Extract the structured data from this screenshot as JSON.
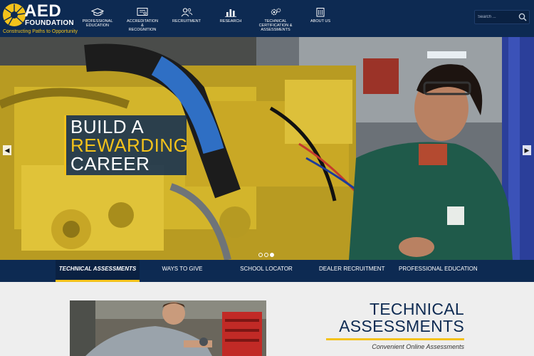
{
  "logo": {
    "name": "AED",
    "subtitle": "FOUNDATION",
    "tagline": "Constructing Paths to Opportunity"
  },
  "nav": {
    "items": [
      {
        "label": "PROFESSIONAL\nEDUCATION",
        "icon": "graduation-cap-icon"
      },
      {
        "label": "ACCREDITATION &\nRECOGNITION",
        "icon": "certificate-icon"
      },
      {
        "label": "RECRUITMENT",
        "icon": "people-icon"
      },
      {
        "label": "RESEARCH",
        "icon": "bar-chart-icon"
      },
      {
        "label": "TECHNICAL\nCERTIFICATION &\nASSESSMENTS",
        "icon": "gears-icon"
      },
      {
        "label": "ABOUT US",
        "icon": "building-icon"
      }
    ]
  },
  "search": {
    "placeholder": "Search ...",
    "icon": "search-icon"
  },
  "hero": {
    "line1": "BUILD A",
    "line2": "REWARDING",
    "line3": "CAREER",
    "slides": 3,
    "active_slide": 3
  },
  "tabs": [
    {
      "label": "TECHNICAL ASSESSMENTS",
      "active": true
    },
    {
      "label": "WAYS TO GIVE",
      "active": false
    },
    {
      "label": "SCHOOL LOCATOR",
      "active": false
    },
    {
      "label": "DEALER RECRUITMENT",
      "active": false
    },
    {
      "label": "PROFESSIONAL EDUCATION",
      "active": false
    }
  ],
  "section": {
    "title_line1": "TECHNICAL",
    "title_line2": "ASSESSMENTS",
    "subtitle": "Convenient Online Assessments"
  },
  "colors": {
    "navy": "#0d2a52",
    "gold": "#f3c21b",
    "background": "#eeeeee"
  }
}
